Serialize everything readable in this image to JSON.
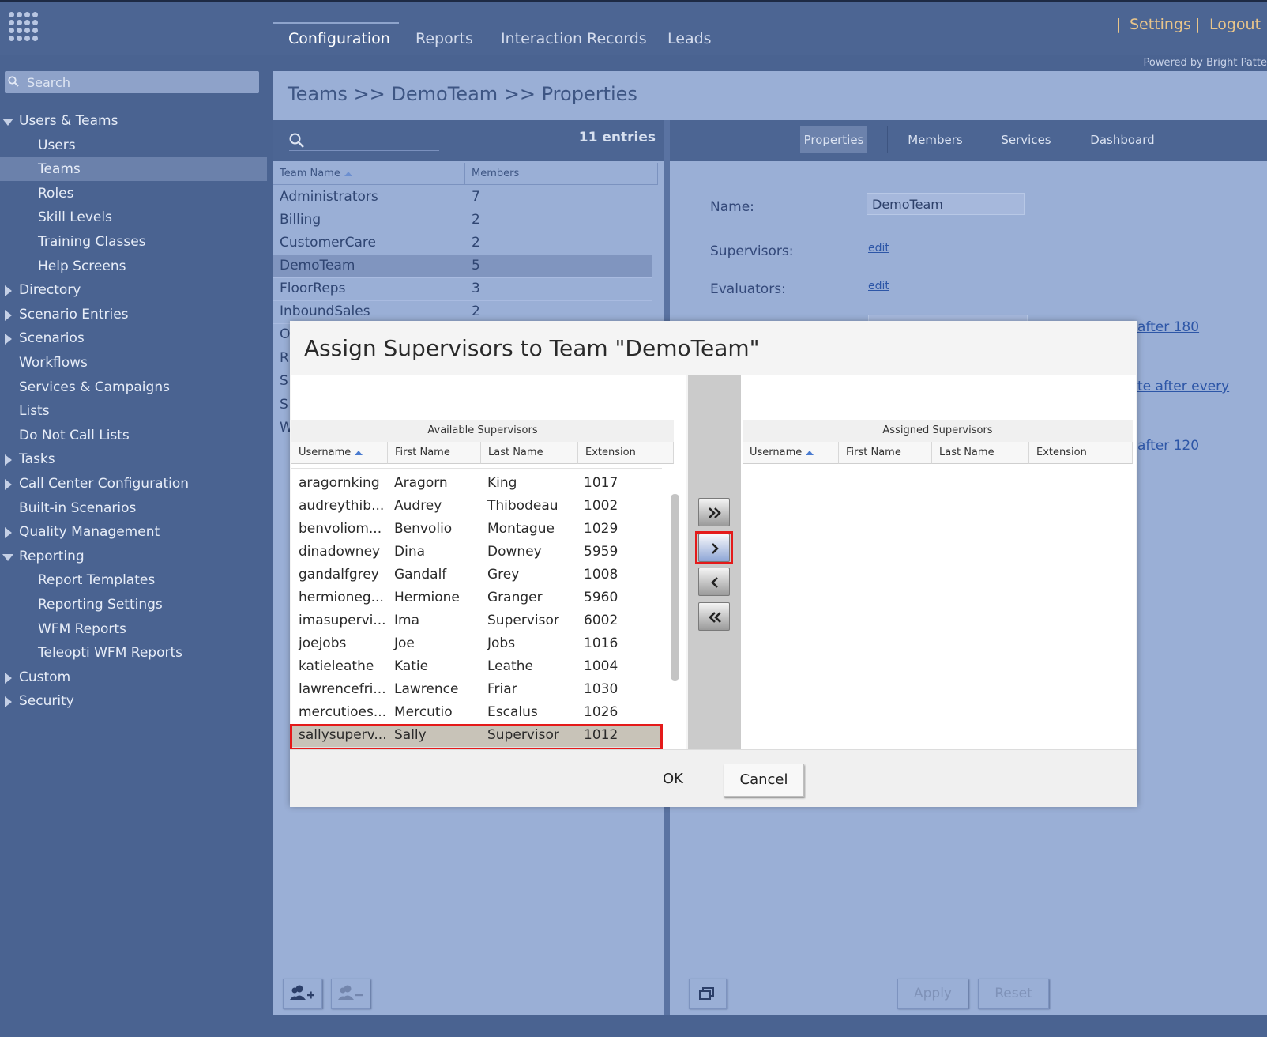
{
  "nav": {
    "tabs": [
      "Configuration",
      "Reports",
      "Interaction Records",
      "Leads"
    ],
    "settings": "Settings",
    "logout": "Logout",
    "pipe": "|",
    "powered_by": "Powered by Bright Patte"
  },
  "sidebar": {
    "search_placeholder": "Search",
    "items": [
      {
        "label": "Users & Teams",
        "level": "top",
        "expander": "expanded"
      },
      {
        "label": "Users",
        "level": "sub"
      },
      {
        "label": "Teams",
        "level": "sub",
        "active": true
      },
      {
        "label": "Roles",
        "level": "sub"
      },
      {
        "label": "Skill Levels",
        "level": "sub"
      },
      {
        "label": "Training Classes",
        "level": "sub"
      },
      {
        "label": "Help Screens",
        "level": "sub"
      },
      {
        "label": "Directory",
        "level": "top",
        "expander": "collapsed"
      },
      {
        "label": "Scenario Entries",
        "level": "top",
        "expander": "collapsed"
      },
      {
        "label": "Scenarios",
        "level": "top",
        "expander": "collapsed"
      },
      {
        "label": "Workflows",
        "level": "top"
      },
      {
        "label": "Services & Campaigns",
        "level": "top"
      },
      {
        "label": "Lists",
        "level": "top"
      },
      {
        "label": "Do Not Call Lists",
        "level": "top"
      },
      {
        "label": "Tasks",
        "level": "top",
        "expander": "collapsed"
      },
      {
        "label": "Call Center Configuration",
        "level": "top",
        "expander": "collapsed"
      },
      {
        "label": "Built-in Scenarios",
        "level": "top"
      },
      {
        "label": "Quality Management",
        "level": "top",
        "expander": "collapsed"
      },
      {
        "label": "Reporting",
        "level": "top",
        "expander": "expanded"
      },
      {
        "label": "Report Templates",
        "level": "sub"
      },
      {
        "label": "Reporting Settings",
        "level": "sub"
      },
      {
        "label": "WFM Reports",
        "level": "sub"
      },
      {
        "label": "Teleopti WFM Reports",
        "level": "sub"
      },
      {
        "label": "Custom",
        "level": "top",
        "expander": "collapsed"
      },
      {
        "label": "Security",
        "level": "top",
        "expander": "collapsed"
      }
    ]
  },
  "main": {
    "breadcrumb": "Teams >> DemoTeam >> Properties",
    "entries": "11 entries",
    "columns": {
      "team_name": "Team Name",
      "members": "Members"
    },
    "rows": [
      {
        "name": "Administrators",
        "members": "7"
      },
      {
        "name": "Billing",
        "members": "2"
      },
      {
        "name": "CustomerCare",
        "members": "2"
      },
      {
        "name": "DemoTeam",
        "members": "5",
        "selected": true
      },
      {
        "name": "FloorReps",
        "members": "3"
      },
      {
        "name": "InboundSales",
        "members": "2"
      }
    ],
    "hidden_row_initials": [
      "O",
      "R",
      "S",
      "S",
      "W"
    ]
  },
  "details": {
    "tabs": [
      "Properties",
      "Members",
      "Services",
      "Dashboard"
    ],
    "name_label": "Name:",
    "name_value": "DemoTeam",
    "supervisors_label": "Supervisors:",
    "evaluators_label": "Evaluators:",
    "edit": "edit",
    "partial_links": [
      "after 180",
      "te after every",
      "after 120"
    ]
  },
  "bottom": {
    "apply": "Apply",
    "reset": "Reset"
  },
  "dialog": {
    "title": "Assign Supervisors to Team \"DemoTeam\"",
    "available_caption": "Available Supervisors",
    "assigned_caption": "Assigned Supervisors",
    "columns": [
      "Username",
      "First Name",
      "Last Name",
      "Extension"
    ],
    "rows": [
      {
        "username": "aragornking",
        "first": "Aragorn",
        "last": "King",
        "ext": "1017"
      },
      {
        "username": "audreythib...",
        "first": "Audrey",
        "last": "Thibodeau",
        "ext": "1002"
      },
      {
        "username": "benvoliom...",
        "first": "Benvolio",
        "last": "Montague",
        "ext": "1029"
      },
      {
        "username": "dinadowney",
        "first": "Dina",
        "last": "Downey",
        "ext": "5959"
      },
      {
        "username": "gandalfgrey",
        "first": "Gandalf",
        "last": "Grey",
        "ext": "1008"
      },
      {
        "username": "hermioneg...",
        "first": "Hermione",
        "last": "Granger",
        "ext": "5960"
      },
      {
        "username": "imasupervi...",
        "first": "Ima",
        "last": "Supervisor",
        "ext": "6002"
      },
      {
        "username": "joejobs",
        "first": "Joe",
        "last": "Jobs",
        "ext": "1016"
      },
      {
        "username": "katieleathe",
        "first": "Katie",
        "last": "Leathe",
        "ext": "1004"
      },
      {
        "username": "lawrencefri...",
        "first": "Lawrence",
        "last": "Friar",
        "ext": "1030"
      },
      {
        "username": "mercutioes...",
        "first": "Mercutio",
        "last": "Escalus",
        "ext": "1026"
      },
      {
        "username": "sallysuperv...",
        "first": "Sally",
        "last": "Supervisor",
        "ext": "1012",
        "selected": true
      }
    ],
    "ok": "OK",
    "cancel": "Cancel"
  },
  "colors": {
    "highlight": "#e41a1a",
    "accent": "#e9c58a",
    "sidebar": "#4a6391"
  }
}
